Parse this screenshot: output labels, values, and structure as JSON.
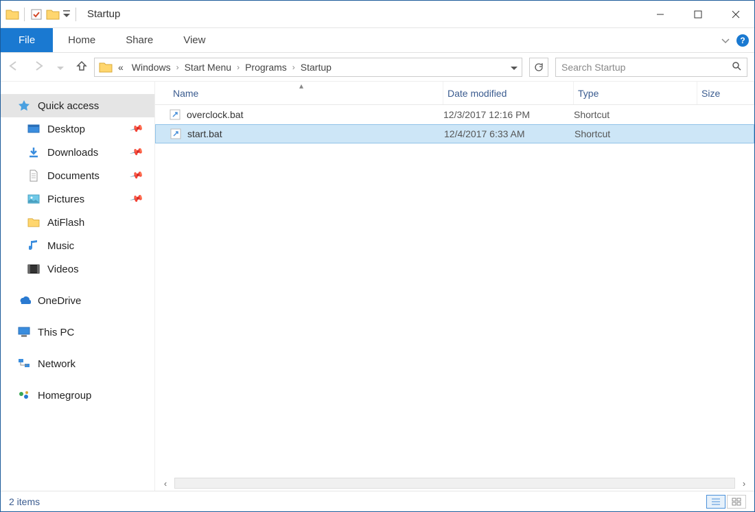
{
  "window": {
    "title": "Startup"
  },
  "ribbon": {
    "file": "File",
    "home": "Home",
    "share": "Share",
    "view": "View"
  },
  "breadcrumbs": {
    "prefix": "«",
    "items": [
      "Windows",
      "Start Menu",
      "Programs",
      "Startup"
    ]
  },
  "search": {
    "placeholder": "Search Startup"
  },
  "sidebar": {
    "quick_access": "Quick access",
    "items": [
      {
        "label": "Desktop",
        "pinned": true,
        "icon": "desktop"
      },
      {
        "label": "Downloads",
        "pinned": true,
        "icon": "download"
      },
      {
        "label": "Documents",
        "pinned": true,
        "icon": "document"
      },
      {
        "label": "Pictures",
        "pinned": true,
        "icon": "pictures"
      },
      {
        "label": "AtiFlash",
        "pinned": false,
        "icon": "folder"
      },
      {
        "label": "Music",
        "pinned": false,
        "icon": "music"
      },
      {
        "label": "Videos",
        "pinned": false,
        "icon": "videos"
      }
    ],
    "onedrive": "OneDrive",
    "thispc": "This PC",
    "network": "Network",
    "homegroup": "Homegroup"
  },
  "columns": {
    "name": "Name",
    "date": "Date modified",
    "type": "Type",
    "size": "Size"
  },
  "files": [
    {
      "name": "overclock.bat",
      "date": "12/3/2017 12:16 PM",
      "type": "Shortcut",
      "selected": false
    },
    {
      "name": "start.bat",
      "date": "12/4/2017 6:33 AM",
      "type": "Shortcut",
      "selected": true
    }
  ],
  "status": {
    "text": "2 items"
  }
}
